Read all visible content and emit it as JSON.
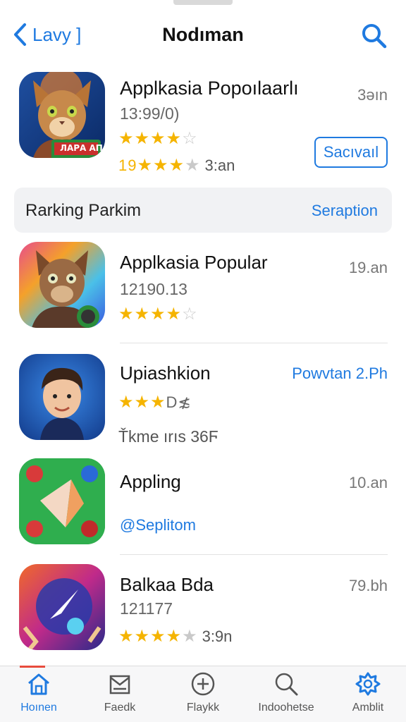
{
  "nav": {
    "back_label": "Lavy ]",
    "title": "Nodıman"
  },
  "featured": {
    "name": "Applkasia Popoılaarlı",
    "sub": "13:99/0)",
    "time": "3əın",
    "stars": 4,
    "rating_text": "19",
    "rating_extra": "3:an",
    "icon_badge_text": "ЛΑΡΑ ΑΠ",
    "button_label": "Sacıvaıl"
  },
  "section": {
    "title": "Rarking Parkim",
    "link": "Seraption"
  },
  "apps": [
    {
      "name": "Applkasia Popular",
      "sub": "12190.13",
      "time": "19.an",
      "stars": 4
    },
    {
      "name": "Upiashkion",
      "link": "Powvtan 2.Ph",
      "stars_text": "D≴",
      "sub": "Ťkme ırıs 36Ϝ"
    },
    {
      "name": "Appling",
      "time": "10.an",
      "link": "@Seplitom"
    },
    {
      "name": "Balkaa Bda",
      "sub": "121177",
      "time": "79.bh",
      "stars": 4,
      "rating_extra": "3:9n"
    }
  ],
  "tabs": [
    {
      "label": "Hoınen",
      "icon": "home-icon"
    },
    {
      "label": "Faedk",
      "icon": "inbox-icon"
    },
    {
      "label": "Flaykk",
      "icon": "plus-circle-icon"
    },
    {
      "label": "Indoohetse",
      "icon": "search-icon"
    },
    {
      "label": "Amblit",
      "icon": "settings-icon"
    }
  ],
  "colors": {
    "accent": "#1f7ae0",
    "star": "#f5b400",
    "star_off": "#c9c9c9"
  }
}
